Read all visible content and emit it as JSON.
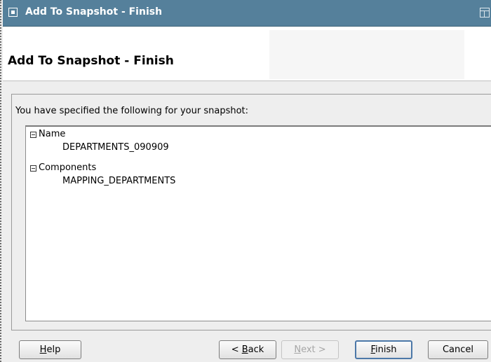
{
  "window": {
    "title": "Add To Snapshot - Finish"
  },
  "header": {
    "title": "Add To Snapshot - Finish"
  },
  "content": {
    "summary_label": "You have specified the following for your snapshot:",
    "tree": [
      {
        "label": "Name",
        "value": "DEPARTMENTS_090909"
      },
      {
        "label": "Components",
        "value": "MAPPING_DEPARTMENTS"
      }
    ]
  },
  "buttons": {
    "help": {
      "mnemonic": "H",
      "rest": "elp"
    },
    "back": {
      "prefix": "< ",
      "mnemonic": "B",
      "rest": "ack"
    },
    "next": {
      "mnemonic": "N",
      "rest": "ext >",
      "enabled": false
    },
    "finish": {
      "mnemonic": "F",
      "rest": "inish"
    },
    "cancel": {
      "label": "Cancel"
    }
  },
  "colors": {
    "titlebar": "#55809b",
    "dialog_background": "#eeeeee",
    "default_button_border": "#4c78a8"
  }
}
